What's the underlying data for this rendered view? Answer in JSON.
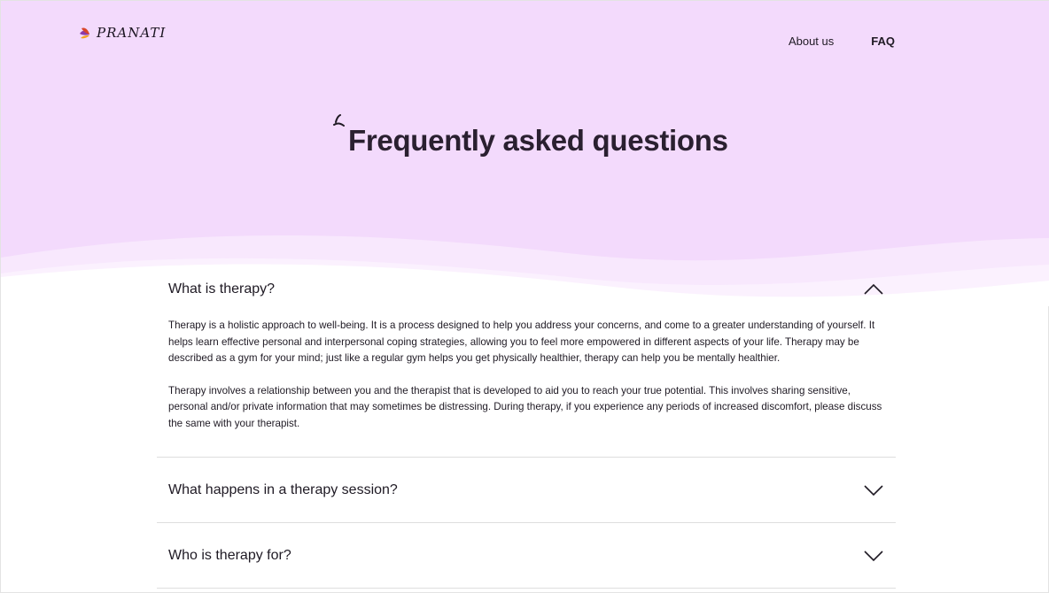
{
  "brand": {
    "name": "PRANATI"
  },
  "nav": {
    "about": "About us",
    "faq": "FAQ"
  },
  "hero": {
    "title": "Frequently asked questions"
  },
  "faq": [
    {
      "question": "What is therapy?",
      "expanded": true,
      "answer": [
        "Therapy is a holistic approach to well-being. It is a process designed to help you address your concerns, and come to a greater understanding of yourself. It helps learn effective personal and interpersonal coping strategies, allowing you to feel more empowered in different aspects of your life. Therapy may be described as a gym for your mind; just like a regular gym helps you get physically healthier, therapy can help you be mentally healthier.",
        "Therapy involves a relationship between you and the therapist that is developed to aid you to reach your true potential. This involves sharing sensitive, personal and/or private information that may sometimes be distressing. During therapy, if you experience any periods of increased discomfort, please discuss the same with your therapist."
      ]
    },
    {
      "question": "What happens in a therapy session?",
      "expanded": false
    },
    {
      "question": "Who is therapy for?",
      "expanded": false
    }
  ],
  "colors": {
    "hero_bg": "#f3dafc",
    "text": "#1f1a24",
    "logo_petal_orange": "#f2a21c",
    "logo_petal_red": "#d9452b",
    "logo_petal_purple": "#8a3ba8"
  },
  "icons": {
    "logo": "flower-petals-icon",
    "title_mark": "sprout-mark-icon",
    "collapse": "chevron-up-icon",
    "expand": "chevron-down-icon"
  }
}
